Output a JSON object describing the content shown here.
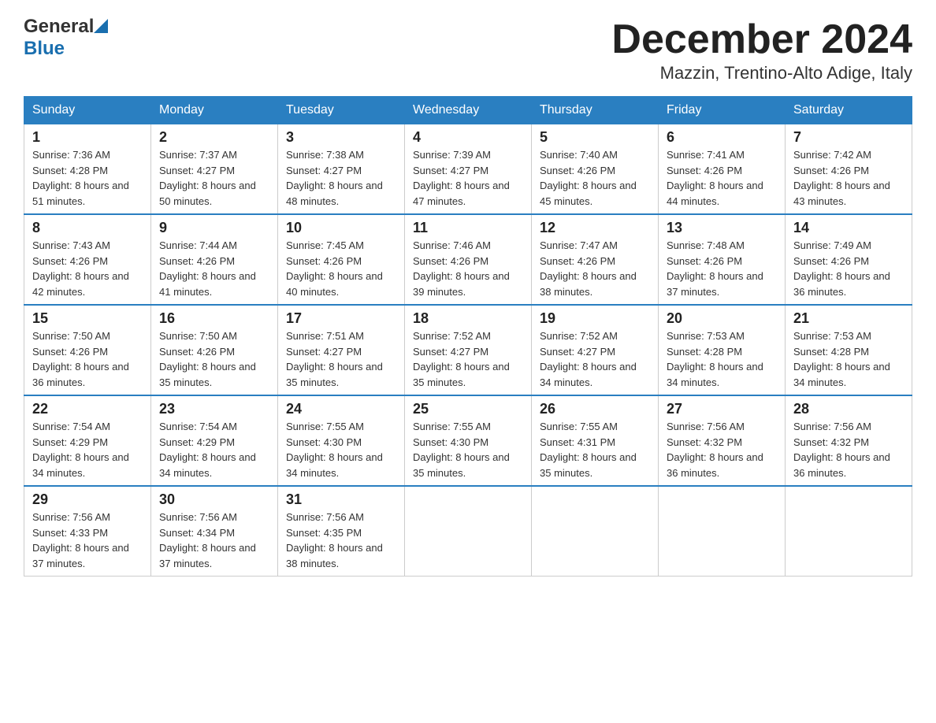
{
  "header": {
    "logo_general": "General",
    "logo_blue": "Blue",
    "month_title": "December 2024",
    "location": "Mazzin, Trentino-Alto Adige, Italy"
  },
  "weekdays": [
    "Sunday",
    "Monday",
    "Tuesday",
    "Wednesday",
    "Thursday",
    "Friday",
    "Saturday"
  ],
  "weeks": [
    [
      {
        "day": "1",
        "sunrise": "7:36 AM",
        "sunset": "4:28 PM",
        "daylight": "8 hours and 51 minutes."
      },
      {
        "day": "2",
        "sunrise": "7:37 AM",
        "sunset": "4:27 PM",
        "daylight": "8 hours and 50 minutes."
      },
      {
        "day": "3",
        "sunrise": "7:38 AM",
        "sunset": "4:27 PM",
        "daylight": "8 hours and 48 minutes."
      },
      {
        "day": "4",
        "sunrise": "7:39 AM",
        "sunset": "4:27 PM",
        "daylight": "8 hours and 47 minutes."
      },
      {
        "day": "5",
        "sunrise": "7:40 AM",
        "sunset": "4:26 PM",
        "daylight": "8 hours and 45 minutes."
      },
      {
        "day": "6",
        "sunrise": "7:41 AM",
        "sunset": "4:26 PM",
        "daylight": "8 hours and 44 minutes."
      },
      {
        "day": "7",
        "sunrise": "7:42 AM",
        "sunset": "4:26 PM",
        "daylight": "8 hours and 43 minutes."
      }
    ],
    [
      {
        "day": "8",
        "sunrise": "7:43 AM",
        "sunset": "4:26 PM",
        "daylight": "8 hours and 42 minutes."
      },
      {
        "day": "9",
        "sunrise": "7:44 AM",
        "sunset": "4:26 PM",
        "daylight": "8 hours and 41 minutes."
      },
      {
        "day": "10",
        "sunrise": "7:45 AM",
        "sunset": "4:26 PM",
        "daylight": "8 hours and 40 minutes."
      },
      {
        "day": "11",
        "sunrise": "7:46 AM",
        "sunset": "4:26 PM",
        "daylight": "8 hours and 39 minutes."
      },
      {
        "day": "12",
        "sunrise": "7:47 AM",
        "sunset": "4:26 PM",
        "daylight": "8 hours and 38 minutes."
      },
      {
        "day": "13",
        "sunrise": "7:48 AM",
        "sunset": "4:26 PM",
        "daylight": "8 hours and 37 minutes."
      },
      {
        "day": "14",
        "sunrise": "7:49 AM",
        "sunset": "4:26 PM",
        "daylight": "8 hours and 36 minutes."
      }
    ],
    [
      {
        "day": "15",
        "sunrise": "7:50 AM",
        "sunset": "4:26 PM",
        "daylight": "8 hours and 36 minutes."
      },
      {
        "day": "16",
        "sunrise": "7:50 AM",
        "sunset": "4:26 PM",
        "daylight": "8 hours and 35 minutes."
      },
      {
        "day": "17",
        "sunrise": "7:51 AM",
        "sunset": "4:27 PM",
        "daylight": "8 hours and 35 minutes."
      },
      {
        "day": "18",
        "sunrise": "7:52 AM",
        "sunset": "4:27 PM",
        "daylight": "8 hours and 35 minutes."
      },
      {
        "day": "19",
        "sunrise": "7:52 AM",
        "sunset": "4:27 PM",
        "daylight": "8 hours and 34 minutes."
      },
      {
        "day": "20",
        "sunrise": "7:53 AM",
        "sunset": "4:28 PM",
        "daylight": "8 hours and 34 minutes."
      },
      {
        "day": "21",
        "sunrise": "7:53 AM",
        "sunset": "4:28 PM",
        "daylight": "8 hours and 34 minutes."
      }
    ],
    [
      {
        "day": "22",
        "sunrise": "7:54 AM",
        "sunset": "4:29 PM",
        "daylight": "8 hours and 34 minutes."
      },
      {
        "day": "23",
        "sunrise": "7:54 AM",
        "sunset": "4:29 PM",
        "daylight": "8 hours and 34 minutes."
      },
      {
        "day": "24",
        "sunrise": "7:55 AM",
        "sunset": "4:30 PM",
        "daylight": "8 hours and 34 minutes."
      },
      {
        "day": "25",
        "sunrise": "7:55 AM",
        "sunset": "4:30 PM",
        "daylight": "8 hours and 35 minutes."
      },
      {
        "day": "26",
        "sunrise": "7:55 AM",
        "sunset": "4:31 PM",
        "daylight": "8 hours and 35 minutes."
      },
      {
        "day": "27",
        "sunrise": "7:56 AM",
        "sunset": "4:32 PM",
        "daylight": "8 hours and 36 minutes."
      },
      {
        "day": "28",
        "sunrise": "7:56 AM",
        "sunset": "4:32 PM",
        "daylight": "8 hours and 36 minutes."
      }
    ],
    [
      {
        "day": "29",
        "sunrise": "7:56 AM",
        "sunset": "4:33 PM",
        "daylight": "8 hours and 37 minutes."
      },
      {
        "day": "30",
        "sunrise": "7:56 AM",
        "sunset": "4:34 PM",
        "daylight": "8 hours and 37 minutes."
      },
      {
        "day": "31",
        "sunrise": "7:56 AM",
        "sunset": "4:35 PM",
        "daylight": "8 hours and 38 minutes."
      },
      null,
      null,
      null,
      null
    ]
  ],
  "labels": {
    "sunrise": "Sunrise:",
    "sunset": "Sunset:",
    "daylight": "Daylight:"
  },
  "colors": {
    "header_bg": "#2a7fc1",
    "accent": "#1a6faf"
  }
}
